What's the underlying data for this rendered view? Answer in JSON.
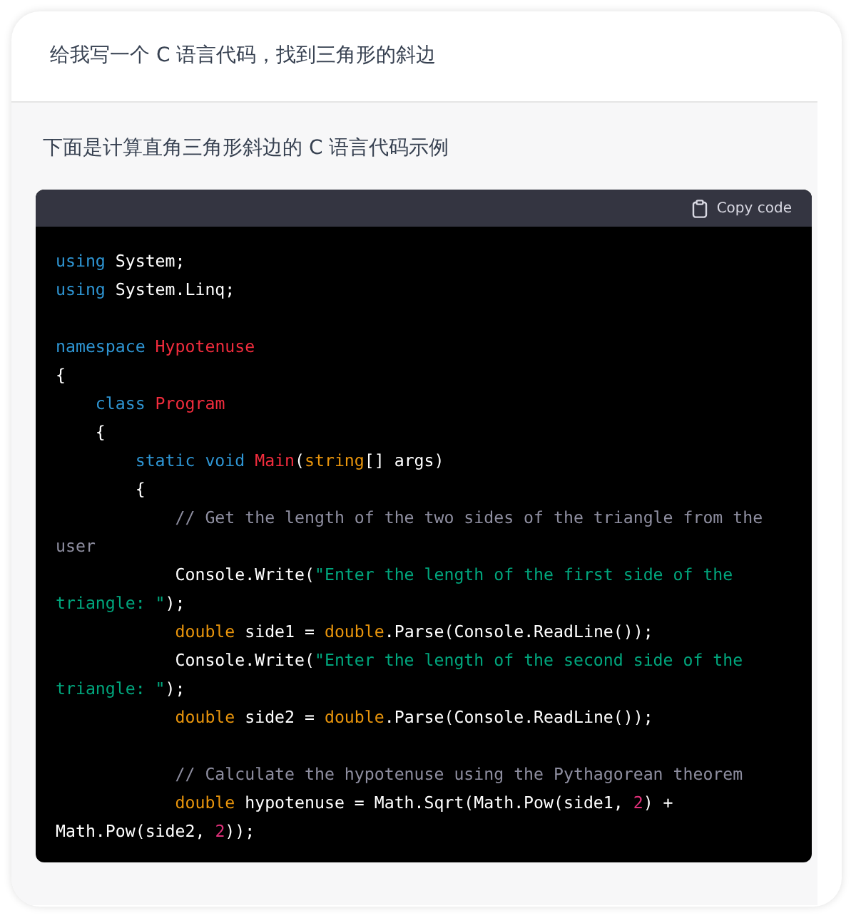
{
  "prompt": {
    "text": "给我写一个 C 语言代码，找到三角形的斜边"
  },
  "reply": {
    "text": "下面是计算直角三角形斜边的 C 语言代码示例",
    "code_block": {
      "copy_label": "Copy code",
      "lines": [
        {
          "kind": "code",
          "tokens": [
            {
              "kind": "keyword",
              "text": "using"
            },
            {
              "kind": "plain",
              "text": " System;"
            }
          ]
        },
        {
          "kind": "code",
          "tokens": [
            {
              "kind": "keyword",
              "text": "using"
            },
            {
              "kind": "plain",
              "text": " System.Linq;"
            }
          ]
        },
        {
          "kind": "blank"
        },
        {
          "kind": "code",
          "tokens": [
            {
              "kind": "keyword",
              "text": "namespace"
            },
            {
              "kind": "title",
              "text": " Hypotenuse"
            }
          ]
        },
        {
          "kind": "code",
          "tokens": [
            {
              "kind": "plain",
              "text": "{"
            }
          ]
        },
        {
          "kind": "code",
          "tokens": [
            {
              "kind": "keyword",
              "text": "    class"
            },
            {
              "kind": "title",
              "text": " Program"
            }
          ]
        },
        {
          "kind": "code",
          "tokens": [
            {
              "kind": "plain",
              "text": "    {"
            }
          ]
        },
        {
          "kind": "code",
          "tokens": [
            {
              "kind": "keyword",
              "text": "        static void"
            },
            {
              "kind": "title",
              "text": " Main"
            },
            {
              "kind": "plain",
              "text": "("
            },
            {
              "kind": "type",
              "text": "string"
            },
            {
              "kind": "plain",
              "text": "[] args)"
            }
          ]
        },
        {
          "kind": "code",
          "tokens": [
            {
              "kind": "plain",
              "text": "        {"
            }
          ]
        },
        {
          "kind": "code",
          "tokens": [
            {
              "kind": "comment",
              "text": "            // Get the length of the two sides of the triangle from the"
            }
          ]
        },
        {
          "kind": "code",
          "tokens": [
            {
              "kind": "comment",
              "text": "user"
            }
          ]
        },
        {
          "kind": "code",
          "tokens": [
            {
              "kind": "plain",
              "text": "            Console.Write("
            },
            {
              "kind": "string",
              "text": "\"Enter the length of the first side of the"
            }
          ]
        },
        {
          "kind": "code",
          "tokens": [
            {
              "kind": "string",
              "text": "triangle: \""
            },
            {
              "kind": "plain",
              "text": ");"
            }
          ]
        },
        {
          "kind": "code",
          "tokens": [
            {
              "kind": "type",
              "text": "            double"
            },
            {
              "kind": "plain",
              "text": " side1 = "
            },
            {
              "kind": "type",
              "text": "double"
            },
            {
              "kind": "plain",
              "text": ".Parse(Console.ReadLine());"
            }
          ]
        },
        {
          "kind": "code",
          "tokens": [
            {
              "kind": "plain",
              "text": "            Console.Write("
            },
            {
              "kind": "string",
              "text": "\"Enter the length of the second side of the"
            }
          ]
        },
        {
          "kind": "code",
          "tokens": [
            {
              "kind": "string",
              "text": "triangle: \""
            },
            {
              "kind": "plain",
              "text": ");"
            }
          ]
        },
        {
          "kind": "code",
          "tokens": [
            {
              "kind": "type",
              "text": "            double"
            },
            {
              "kind": "plain",
              "text": " side2 = "
            },
            {
              "kind": "type",
              "text": "double"
            },
            {
              "kind": "plain",
              "text": ".Parse(Console.ReadLine());"
            }
          ]
        },
        {
          "kind": "blank"
        },
        {
          "kind": "code",
          "tokens": [
            {
              "kind": "comment",
              "text": "            // Calculate the hypotenuse using the Pythagorean theorem"
            }
          ]
        },
        {
          "kind": "code",
          "tokens": [
            {
              "kind": "type",
              "text": "            double"
            },
            {
              "kind": "plain",
              "text": " hypotenuse = Math.Sqrt(Math.Pow(side1, "
            },
            {
              "kind": "number",
              "text": "2"
            },
            {
              "kind": "plain",
              "text": ") +"
            }
          ]
        },
        {
          "kind": "code",
          "tokens": [
            {
              "kind": "plain",
              "text": "Math.Pow(side2, "
            },
            {
              "kind": "number",
              "text": "2"
            },
            {
              "kind": "plain",
              "text": "));"
            }
          ]
        }
      ]
    }
  }
}
